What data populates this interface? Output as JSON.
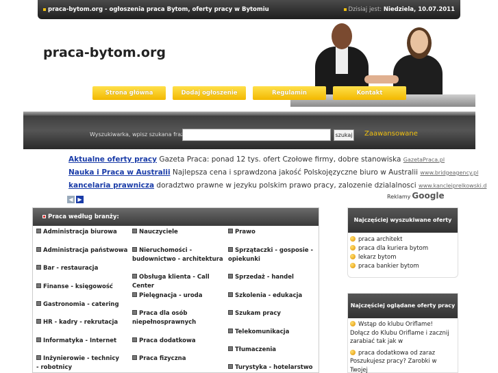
{
  "topbar": {
    "site_line": "praca-bytom.org - ogłoszenia praca Bytom, oferty pracy w Bytomiu",
    "date_label": "Dzisiaj jest:",
    "date_value": "Niedziela, 10.07.2011"
  },
  "header": {
    "logo": "praca-bytom.org",
    "nav": [
      "Strona główna",
      "Dodaj ogłoszenie",
      "Regulamin",
      "Kontakt"
    ]
  },
  "search": {
    "label": "Wyszukiwarka, wpisz szukana frazę:",
    "value": "",
    "button": "szukaj",
    "advanced": "Zaawansowane"
  },
  "ads": [
    {
      "title": "Aktualne oferty pracy",
      "desc": " Gazeta Praca: ponad 12 tys. ofert Czołowe firmy, dobre stanowiska ",
      "url": "GazetaPraca.pl"
    },
    {
      "title": "Nauka i Praca w Australii",
      "desc": " Najlepsza cena i sprawdzona jakość Polskojęzyczne biuro w Australii ",
      "url": "www.bridgeagency.pl"
    },
    {
      "title": "kancelaria prawnicza",
      "desc": " doradztwo prawne w jezyku polskim prawo pracy, zalozenie dzialalnosci ",
      "url": "www.kancleiprelkowski.d"
    }
  ],
  "ads_footer": {
    "label": "Reklamy",
    "brand": "Google"
  },
  "categories": {
    "title": "Praca według branży:",
    "col1": [
      "Administracja biurowa",
      "Administracja państwowa",
      "Bar - restauracja",
      "Finanse - księgowość",
      "Gastronomia - catering",
      "HR - kadry - rekrutacja",
      "Informatyka - Internet",
      "Inżynierowie - technicy - robotnicy"
    ],
    "col2": [
      "Nauczyciele",
      "Nieruchomości - budownictwo - architektura",
      "Obsługa klienta - Call Center",
      "Pielęgnacja - uroda",
      "Praca dla osób niepełnosprawnych",
      "Praca dodatkowa",
      "Praca fizyczna"
    ],
    "col3": [
      "Prawo",
      "Sprzątaczki - gosposie - opiekunki",
      "Sprzedaż - handel",
      "Szkolenia - edukacja",
      "Szukam pracy",
      "Telekomunikacja",
      "Tłumaczenia",
      "Turystyka - hotelarstwo"
    ]
  },
  "searched": {
    "title": "Najczęściej wyszukiwane oferty",
    "items": [
      "praca architekt",
      "praca dla kuriera bytom",
      "lekarz bytom",
      "praca bankier bytom"
    ]
  },
  "viewed": {
    "title": "Najczęściej oglądane oferty pracy",
    "items": [
      {
        "head": "Wstąp do klubu Oriflame!",
        "body": "Dołącz do Klubu Oriflame i zacznij zarabiać tak jak w"
      },
      {
        "head": "praca dodatkowa od zaraz",
        "body": "Poszukujesz pracy? Zarobki w Twojej"
      }
    ]
  },
  "colors": {
    "accent": "#f2b800",
    "link": "#1a3ca8",
    "dark": "#333333"
  }
}
